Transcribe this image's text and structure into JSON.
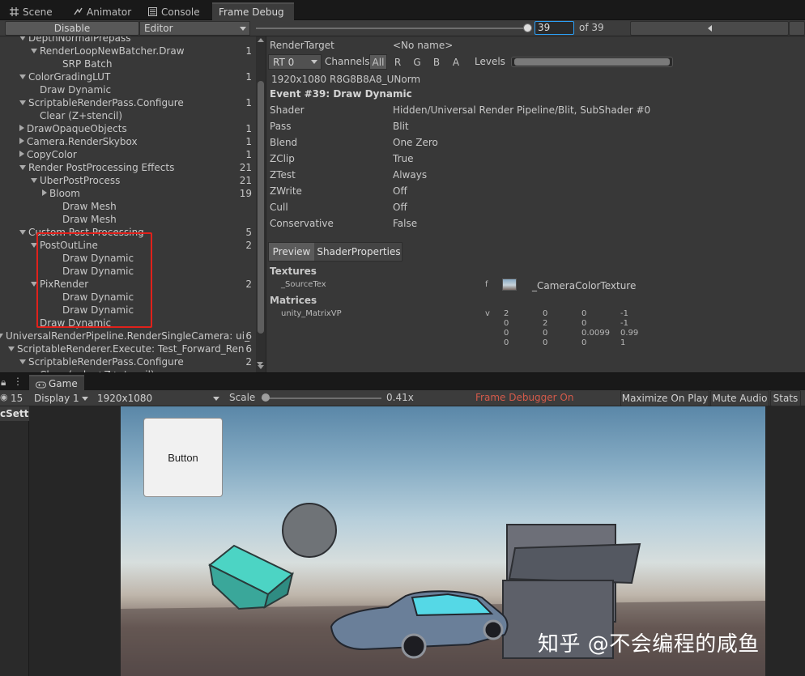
{
  "tabs": [
    {
      "label": "Scene",
      "icon": "grid-icon"
    },
    {
      "label": "Animator",
      "icon": "animator-icon"
    },
    {
      "label": "Console",
      "icon": "console-icon"
    },
    {
      "label": "Frame Debug",
      "icon": ""
    }
  ],
  "toolbar": {
    "disable_label": "Disable",
    "target_value": "Editor",
    "event_index": "39",
    "event_total": "of 39",
    "event_fraction": 1.0
  },
  "tree": [
    {
      "label": "DepthNormalPrepass",
      "count": "",
      "expander": "down"
    },
    {
      "label": "RenderLoopNewBatcher.Draw",
      "count": "1",
      "expander": "down"
    },
    {
      "label": "SRP Batch",
      "count": "",
      "expander": ""
    },
    {
      "label": "ColorGradingLUT",
      "count": "1",
      "expander": "down"
    },
    {
      "label": "Draw Dynamic",
      "count": "",
      "expander": ""
    },
    {
      "label": "ScriptableRenderPass.Configure",
      "count": "1",
      "expander": "down"
    },
    {
      "label": "Clear (Z+stencil)",
      "count": "",
      "expander": ""
    },
    {
      "label": "DrawOpaqueObjects",
      "count": "1",
      "expander": "right"
    },
    {
      "label": "Camera.RenderSkybox",
      "count": "1",
      "expander": "right"
    },
    {
      "label": "CopyColor",
      "count": "1",
      "expander": "right"
    },
    {
      "label": "Render PostProcessing Effects",
      "count": "21",
      "expander": "down"
    },
    {
      "label": "UberPostProcess",
      "count": "21",
      "expander": "down"
    },
    {
      "label": "Bloom",
      "count": "19",
      "expander": "right"
    },
    {
      "label": "Draw Mesh",
      "count": "",
      "expander": ""
    },
    {
      "label": "Draw Mesh",
      "count": "",
      "expander": ""
    },
    {
      "label": "Custom Post Processing",
      "count": "5",
      "expander": "down"
    },
    {
      "label": "PostOutLine",
      "count": "2",
      "expander": "down"
    },
    {
      "label": "Draw Dynamic",
      "count": "",
      "expander": ""
    },
    {
      "label": "Draw Dynamic",
      "count": "",
      "expander": ""
    },
    {
      "label": "PixRender",
      "count": "2",
      "expander": "down"
    },
    {
      "label": "Draw Dynamic",
      "count": "",
      "expander": ""
    },
    {
      "label": "Draw Dynamic",
      "count": "",
      "expander": ""
    },
    {
      "label": "Draw Dynamic",
      "count": "",
      "expander": ""
    },
    {
      "label": "UniversalRenderPipeline.RenderSingleCamera: ui_",
      "count": "6",
      "expander": "down"
    },
    {
      "label": "ScriptableRenderer.Execute: Test_Forward_Ren",
      "count": "6",
      "expander": "down"
    },
    {
      "label": "ScriptableRenderPass.Configure",
      "count": "2",
      "expander": "down"
    },
    {
      "label": "Clear (color+Z+stencil)",
      "count": "",
      "expander": ""
    }
  ],
  "detail": {
    "render_target_label": "RenderTarget",
    "render_target_value": "<No name>",
    "rt_value": "RT 0",
    "channels_label": "Channels",
    "channels": [
      "All",
      "R",
      "G",
      "B",
      "A"
    ],
    "levels_label": "Levels",
    "format": "1920x1080 R8G8B8A8_UNorm",
    "event_title": "Event #39: Draw Dynamic",
    "props": [
      {
        "key": "Shader",
        "value": "Hidden/Universal Render Pipeline/Blit, SubShader #0"
      },
      {
        "key": "Pass",
        "value": "Blit"
      },
      {
        "key": "Blend",
        "value": "One Zero"
      },
      {
        "key": "ZClip",
        "value": "True"
      },
      {
        "key": "ZTest",
        "value": "Always"
      },
      {
        "key": "ZWrite",
        "value": "Off"
      },
      {
        "key": "Cull",
        "value": "Off"
      },
      {
        "key": "Conservative",
        "value": "False"
      }
    ],
    "subtabs": [
      "Preview",
      "ShaderProperties"
    ],
    "textures_header": "Textures",
    "texture": {
      "name": "_SourceTex",
      "stage": "f",
      "value": "_CameraColorTexture"
    },
    "matrices_header": "Matrices",
    "matrix": {
      "name": "unity_MatrixVP",
      "stage": "v",
      "rows": [
        [
          "2",
          "0",
          "0",
          "-1"
        ],
        [
          "0",
          "2",
          "0",
          "-1"
        ],
        [
          "0",
          "0",
          "0.0099",
          "0.99"
        ],
        [
          "0",
          "0",
          "0",
          "1"
        ]
      ]
    }
  },
  "game": {
    "tab_label": "Game",
    "hidden_count": "15",
    "left_partial": "cSetti",
    "display": "Display 1",
    "resolution": "1920x1080",
    "scale_label": "Scale",
    "scale_value": "0.41x",
    "scale_fraction": 0.0,
    "frame_debugger_status": "Frame Debugger On",
    "status_color": "#d35a4a",
    "buttons": [
      "Maximize On Play",
      "Mute Audio",
      "Stats"
    ],
    "ui_button_label": "Button"
  },
  "watermark": "知乎 @不会编程的咸鱼"
}
